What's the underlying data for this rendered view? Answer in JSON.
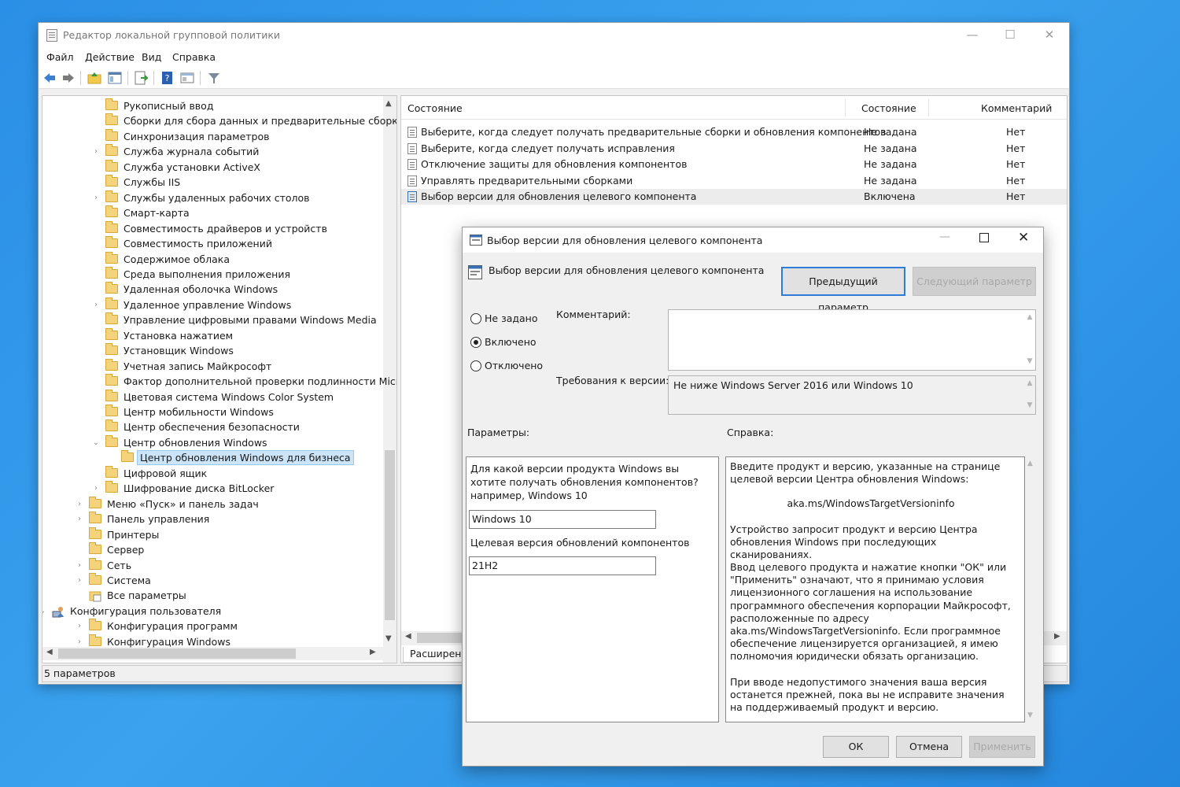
{
  "window": {
    "title": "Редактор локальной групповой политики",
    "minimize": "—",
    "maximize": "☐",
    "close": "✕"
  },
  "menu": [
    "Файл",
    "Действие",
    "Вид",
    "Справка"
  ],
  "tree": [
    {
      "label": "Рукописный ввод",
      "level": 2,
      "exp": ""
    },
    {
      "label": "Сборки для сбора данных и предварительные сборки",
      "level": 2,
      "exp": ""
    },
    {
      "label": "Синхронизация параметров",
      "level": 2,
      "exp": ""
    },
    {
      "label": "Служба журнала событий",
      "level": 2,
      "exp": "›"
    },
    {
      "label": "Служба установки ActiveX",
      "level": 2,
      "exp": ""
    },
    {
      "label": "Службы IIS",
      "level": 2,
      "exp": ""
    },
    {
      "label": "Службы удаленных рабочих столов",
      "level": 2,
      "exp": "›"
    },
    {
      "label": "Смарт-карта",
      "level": 2,
      "exp": ""
    },
    {
      "label": "Совместимость драйверов и устройств",
      "level": 2,
      "exp": ""
    },
    {
      "label": "Совместимость приложений",
      "level": 2,
      "exp": ""
    },
    {
      "label": "Содержимое облака",
      "level": 2,
      "exp": ""
    },
    {
      "label": "Среда выполнения приложения",
      "level": 2,
      "exp": ""
    },
    {
      "label": "Удаленная оболочка Windows",
      "level": 2,
      "exp": ""
    },
    {
      "label": "Удаленное управление Windows",
      "level": 2,
      "exp": "›"
    },
    {
      "label": "Управление цифровыми правами Windows Media",
      "level": 2,
      "exp": ""
    },
    {
      "label": "Установка нажатием",
      "level": 2,
      "exp": ""
    },
    {
      "label": "Установщик Windows",
      "level": 2,
      "exp": ""
    },
    {
      "label": "Учетная запись Майкрософт",
      "level": 2,
      "exp": ""
    },
    {
      "label": "Фактор дополнительной проверки подлинности Micr",
      "level": 2,
      "exp": ""
    },
    {
      "label": "Цветовая система Windows Color System",
      "level": 2,
      "exp": ""
    },
    {
      "label": "Центр мобильности Windows",
      "level": 2,
      "exp": ""
    },
    {
      "label": "Центр обеспечения безопасности",
      "level": 2,
      "exp": ""
    },
    {
      "label": "Центр обновления Windows",
      "level": 2,
      "exp": "⌄"
    },
    {
      "label": "Центр обновления Windows для бизнеса",
      "level": 3,
      "exp": "",
      "selected": true
    },
    {
      "label": "Цифровой ящик",
      "level": 2,
      "exp": ""
    },
    {
      "label": "Шифрование диска BitLocker",
      "level": 2,
      "exp": "›"
    },
    {
      "label": "Меню «Пуск» и панель задач",
      "level": 1,
      "exp": "›"
    },
    {
      "label": "Панель управления",
      "level": 1,
      "exp": "›"
    },
    {
      "label": "Принтеры",
      "level": 1,
      "exp": ""
    },
    {
      "label": "Сервер",
      "level": 1,
      "exp": ""
    },
    {
      "label": "Сеть",
      "level": 1,
      "exp": "›"
    },
    {
      "label": "Система",
      "level": 1,
      "exp": "›"
    },
    {
      "label": "Все параметры",
      "level": 1,
      "exp": "",
      "icon": "settings"
    },
    {
      "label": "Конфигурация пользователя",
      "level": 0,
      "exp": "⌄",
      "icon": "user"
    },
    {
      "label": "Конфигурация программ",
      "level": 1,
      "exp": "›"
    },
    {
      "label": "Конфигурация Windows",
      "level": 1,
      "exp": "›"
    }
  ],
  "list": {
    "headers": {
      "name": "Состояние",
      "state": "Состояние",
      "comment": "Комментарий"
    },
    "rows": [
      {
        "name": "Выберите, когда следует получать предварительные сборки и обновления компонентов",
        "state": "Не задана",
        "comment": "Нет"
      },
      {
        "name": "Выберите, когда следует получать исправления",
        "state": "Не задана",
        "comment": "Нет"
      },
      {
        "name": "Отключение защиты для обновления компонентов",
        "state": "Не задана",
        "comment": "Нет"
      },
      {
        "name": "Управлять предварительными сборками",
        "state": "Не задана",
        "comment": "Нет"
      },
      {
        "name": "Выбор версии для обновления целевого компонента",
        "state": "Включена",
        "comment": "Нет"
      }
    ],
    "tab": "Расширенн"
  },
  "status": "5 параметров",
  "dialog": {
    "title": "Выбор версии для обновления целевого компонента",
    "policy_name": "Выбор версии для обновления целевого компонента",
    "prev_btn": "Предыдущий параметр",
    "next_btn": "Следующий параметр",
    "radios": [
      "Не задано",
      "Включено",
      "Отключено"
    ],
    "selected_radio": "Включено",
    "comment_label": "Комментарий:",
    "comment_value": "",
    "req_label": "Требования к версии:",
    "req_value": "Не ниже Windows Server 2016 или Windows 10",
    "params_label": "Параметры:",
    "help_label": "Справка:",
    "q1": "Для какой версии продукта Windows вы хотите получать обновления компонентов? например, Windows 10",
    "v1": "Windows 10",
    "q2": "Целевая версия обновлений компонентов",
    "v2": "21H2",
    "help_p1": "Введите продукт и версию, указанные на странице целевой версии Центра обновления Windows:",
    "help_link": "aka.ms/WindowsTargetVersioninfo",
    "help_p2": "Устройство запросит продукт и версию Центра обновления Windows при последующих сканированиях.",
    "help_p3": "Ввод целевого продукта и нажатие кнопки \"ОК\" или \"Применить\" означают, что я принимаю условия лицензионного соглашения на использование программного обеспечения корпорации Майкрософт, расположенные по адресу aka.ms/WindowsTargetVersioninfo. Если программное обеспечение лицензируется организацией, я имею полномочия юридически обязать организацию.",
    "help_p4": "При вводе недопустимого значения ваша версия останется прежней, пока вы не исправите значения на поддерживаемый продукт и версию.",
    "ok": "ОК",
    "cancel": "Отмена",
    "apply": "Применить"
  }
}
